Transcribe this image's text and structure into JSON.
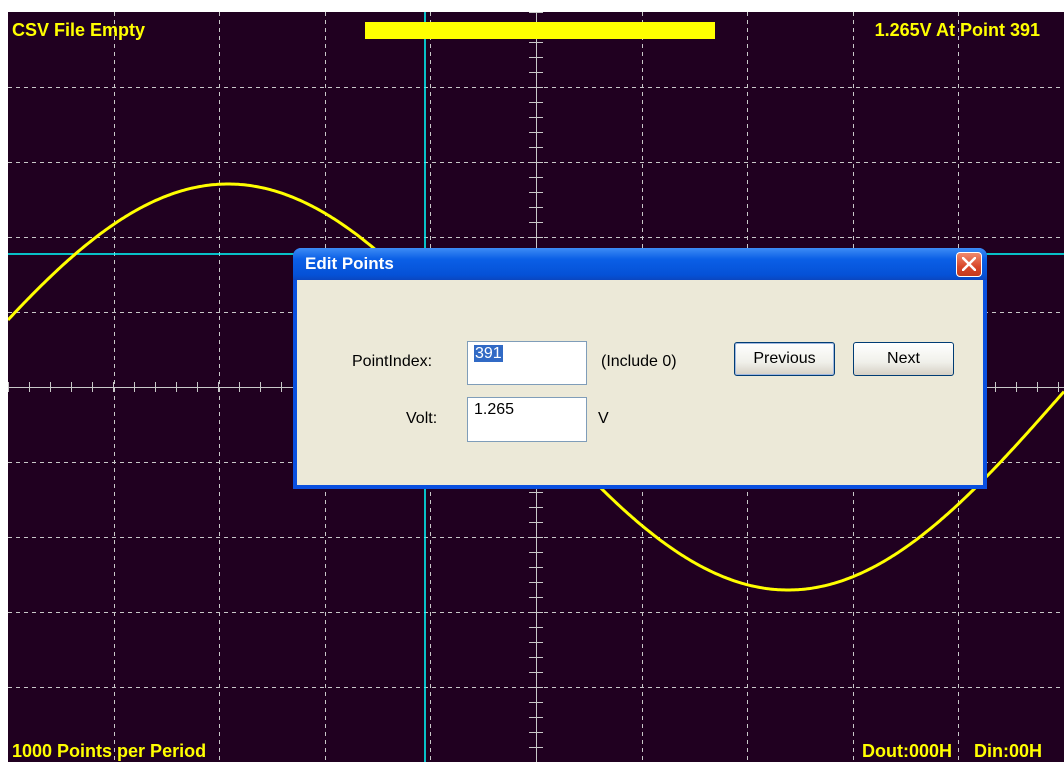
{
  "scope": {
    "file_status": "CSV File Empty",
    "voltage_readout": "1.265V At Point 391",
    "points_per_period": "1000 Points per Period",
    "dout": "Dout:000H",
    "din": "Din:00H",
    "colors": {
      "background": "#200020",
      "grid": "#c8c8c8",
      "waveform": "#ffff00",
      "cursor": "#00ffff",
      "text": "#ffff00"
    },
    "waveform": {
      "shape": "sine",
      "points_per_period": 1000,
      "cursor_point": 391,
      "cursor_volt": 1.265
    }
  },
  "dialog": {
    "title": "Edit Points",
    "pointindex_label": "PointIndex:",
    "pointindex_value": "391",
    "include_note": "(Include 0)",
    "volt_label": "Volt:",
    "volt_value": "1.265",
    "volt_unit": "V",
    "previous_label": "Previous",
    "next_label": "Next"
  }
}
